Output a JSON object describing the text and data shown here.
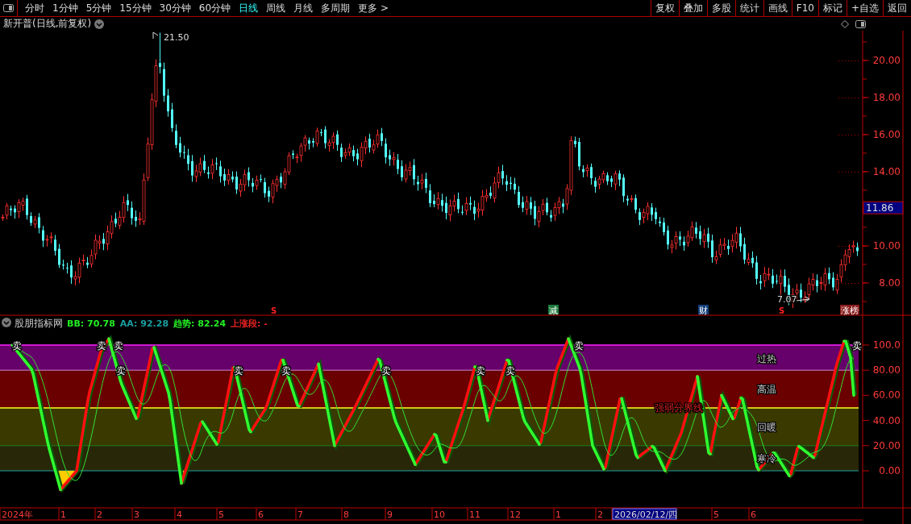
{
  "toolbar": {
    "periods": [
      {
        "label": "分时",
        "selected": false
      },
      {
        "label": "1分钟",
        "selected": false
      },
      {
        "label": "5分钟",
        "selected": false
      },
      {
        "label": "15分钟",
        "selected": false
      },
      {
        "label": "30分钟",
        "selected": false
      },
      {
        "label": "60分钟",
        "selected": false
      },
      {
        "label": "日线",
        "selected": true
      },
      {
        "label": "周线",
        "selected": false
      },
      {
        "label": "月线",
        "selected": false
      },
      {
        "label": "多周期",
        "selected": false
      },
      {
        "label": "更多 >",
        "selected": false
      }
    ],
    "buttons": [
      "复权",
      "叠加",
      "多股",
      "统计",
      "画线",
      "F10",
      "标记",
      "+自选",
      "返回"
    ]
  },
  "chart_title": "新开普(日线,前复权)",
  "price_axis": {
    "labels": [
      "20.00",
      "18.00",
      "16.00",
      "14.00",
      "10.00",
      "8.00"
    ],
    "current_price": "11.86"
  },
  "annotations": {
    "high": "21.50",
    "low": "7.07"
  },
  "event_markers": [
    {
      "label": "S",
      "kind": "signal"
    },
    {
      "label": "减",
      "kind": "tag",
      "color": "#1e7a3c"
    },
    {
      "label": "财",
      "kind": "tag",
      "color": "#123f7a"
    },
    {
      "label": "S",
      "kind": "signal"
    },
    {
      "label": "涨榜",
      "kind": "tag",
      "color": "#8a1c1c"
    }
  ],
  "indicator": {
    "name": "股朋指标网",
    "values": [
      {
        "text": "BB: 70.78",
        "color": "#22ee22"
      },
      {
        "text": "AA: 92.28",
        "color": "#1a9ea0"
      },
      {
        "text": "趋势: 82.24",
        "color": "#22ee22"
      },
      {
        "text": "上涨段: -",
        "color": "#ee2222"
      }
    ],
    "bands": [
      "过热",
      "高温",
      "回暖",
      "寒冷"
    ],
    "boundary_label": "强弱分界线",
    "axis_labels": [
      "100.0",
      "80.00",
      "60.00",
      "40.00",
      "20.00",
      "0.00"
    ],
    "sell_signals": [
      "卖",
      "卖",
      "卖",
      "卖",
      "卖",
      "卖",
      "卖",
      "卖",
      "卖",
      "卖",
      "卖"
    ]
  },
  "time_axis": [
    {
      "label": "2024年",
      "selected": false
    },
    {
      "label": "1",
      "selected": false
    },
    {
      "label": "2",
      "selected": false
    },
    {
      "label": "3",
      "selected": false
    },
    {
      "label": "4",
      "selected": false
    },
    {
      "label": "5",
      "selected": false
    },
    {
      "label": "6",
      "selected": false
    },
    {
      "label": "7",
      "selected": false
    },
    {
      "label": "8",
      "selected": false
    },
    {
      "label": "9",
      "selected": false
    },
    {
      "label": "10",
      "selected": false
    },
    {
      "label": "11",
      "selected": false
    },
    {
      "label": "12",
      "selected": false
    },
    {
      "label": "1",
      "selected": false
    },
    {
      "label": "2",
      "selected": false
    },
    {
      "label": "2026/02/12/四",
      "selected": true
    },
    {
      "label": "5",
      "selected": false
    },
    {
      "label": "6",
      "selected": false
    }
  ]
}
